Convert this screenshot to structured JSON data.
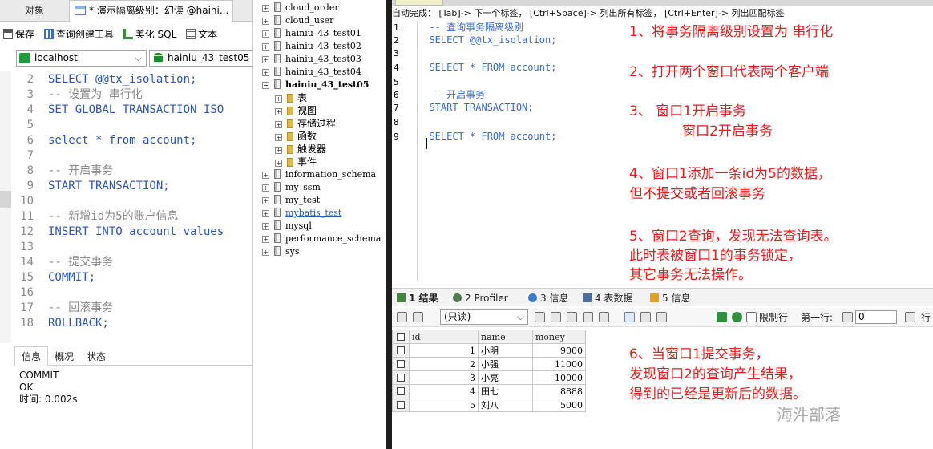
{
  "left": {
    "tabs": {
      "objects": "对象",
      "query": "* 演示隔离级别：幻读 @haini..."
    },
    "toolbar": {
      "save": "保存",
      "query_builder": "查询创建工具",
      "beautify": "美化 SQL",
      "text": "文本"
    },
    "connection": {
      "host": "localhost",
      "database": "hainiu_43_test05"
    },
    "code_lines": [
      {
        "n": "2",
        "text": "SELECT @@tx_isolation;",
        "kind": "kw"
      },
      {
        "n": "3",
        "text": "-- 设置为 串行化",
        "kind": "cm"
      },
      {
        "n": "4",
        "text": "SET GLOBAL TRANSACTION ISO",
        "kind": "kw"
      },
      {
        "n": "5",
        "text": "",
        "kind": "id"
      },
      {
        "n": "6",
        "text": "select * from account;",
        "kind": "mixed"
      },
      {
        "n": "7",
        "text": "",
        "kind": "id"
      },
      {
        "n": "8",
        "text": "-- 开启事务",
        "kind": "cm"
      },
      {
        "n": "9",
        "text": "START TRANSACTION;",
        "kind": "kw"
      },
      {
        "n": "10",
        "text": "",
        "kind": "id"
      },
      {
        "n": "11",
        "text": "-- 新增id为5的账户信息",
        "kind": "cm"
      },
      {
        "n": "12",
        "text": "INSERT INTO account values",
        "kind": "mixed2"
      },
      {
        "n": "13",
        "text": "",
        "kind": "id"
      },
      {
        "n": "14",
        "text": "-- 提交事务",
        "kind": "cm"
      },
      {
        "n": "15",
        "text": "COMMIT;",
        "kind": "kw"
      },
      {
        "n": "16",
        "text": "",
        "kind": "id"
      },
      {
        "n": "17",
        "text": "-- 回滚事务",
        "kind": "cm"
      },
      {
        "n": "18",
        "text": "ROLLBACK;",
        "kind": "kw"
      }
    ],
    "bottom_tabs": [
      "信息",
      "概况",
      "状态"
    ],
    "messages": [
      "COMMIT",
      "OK",
      "时间: 0.002s"
    ]
  },
  "tree": [
    {
      "label": "cloud_order",
      "type": "db",
      "indent": 0
    },
    {
      "label": "cloud_user",
      "type": "db",
      "indent": 0
    },
    {
      "label": "hainiu_43_test01",
      "type": "db",
      "indent": 0
    },
    {
      "label": "hainiu_43_test02",
      "type": "db",
      "indent": 0
    },
    {
      "label": "hainiu_43_test03",
      "type": "db",
      "indent": 0
    },
    {
      "label": "hainiu_43_test04",
      "type": "db",
      "indent": 0
    },
    {
      "label": "hainiu_43_test05",
      "type": "db-open",
      "indent": 0
    },
    {
      "label": "表",
      "type": "folder",
      "indent": 1
    },
    {
      "label": "视图",
      "type": "folder",
      "indent": 1
    },
    {
      "label": "存储过程",
      "type": "folder",
      "indent": 1
    },
    {
      "label": "函数",
      "type": "folder",
      "indent": 1
    },
    {
      "label": "触发器",
      "type": "folder",
      "indent": 1
    },
    {
      "label": "事件",
      "type": "folder",
      "indent": 1
    },
    {
      "label": "information_schema",
      "type": "db",
      "indent": 0
    },
    {
      "label": "my_ssm",
      "type": "db",
      "indent": 0
    },
    {
      "label": "my_test",
      "type": "db",
      "indent": 0
    },
    {
      "label": "mybatis_test",
      "type": "db-link",
      "indent": 0
    },
    {
      "label": "mysql",
      "type": "db",
      "indent": 0
    },
    {
      "label": "performance_schema",
      "type": "db",
      "indent": 0
    },
    {
      "label": "sys",
      "type": "db",
      "indent": 0
    }
  ],
  "right": {
    "hint": "自动完成： [Tab]-> 下一个标签， [Ctrl+Space]-> 列出所有标签， [Ctrl+Enter]-> 列出匹配标签",
    "editor_lines": [
      {
        "n": "1",
        "text": "  -- 查询事务隔离级别",
        "kind": "cm"
      },
      {
        "n": "2",
        "text": "  SELECT @@tx_isolation;",
        "kind": "sel"
      },
      {
        "n": "3",
        "text": "",
        "kind": "plain"
      },
      {
        "n": "4",
        "text": "  SELECT * FROM account;",
        "kind": "star"
      },
      {
        "n": "5",
        "text": "",
        "kind": "plain"
      },
      {
        "n": "6",
        "text": "  -- 开启事务",
        "kind": "cm"
      },
      {
        "n": "7",
        "text": "  START TRANSACTION;",
        "kind": "kw"
      },
      {
        "n": "8",
        "text": "",
        "kind": "plain"
      },
      {
        "n": "9",
        "text": "  SELECT * FROM account;",
        "kind": "star"
      }
    ],
    "notes": {
      "n1": "1、将事务隔离级别设置为 串行化",
      "n2": "2、打开两个窗口代表两个客户端",
      "n3a": "3、      窗口1开启事务",
      "n3b": "窗口2开启事务",
      "n4a": "4、窗口1添加一条id为5的数据，",
      "n4b": "但不提交或者回滚事务",
      "n5a": "5、窗口2查询，发现无法查询表。",
      "n5b": "此时表被窗口1的事务锁定，",
      "n5c": "其它事务无法操作。",
      "n6a": "6、当窗口1提交事务，",
      "n6b": "发现窗口2的查询产生结果，",
      "n6c": "得到的已经是更新后的数据。"
    },
    "result_tabs": [
      {
        "num": "1",
        "label": "结果"
      },
      {
        "num": "2",
        "label": "Profiler"
      },
      {
        "num": "3",
        "label": "信息"
      },
      {
        "num": "4",
        "label": "表数据"
      },
      {
        "num": "5",
        "label": "信息"
      }
    ],
    "readonly_select": "(只读)",
    "limit_label": "限制行",
    "first_row_label": "第一行:",
    "first_row_value": "0",
    "row_label": "行",
    "columns": [
      "id",
      "name",
      "money"
    ],
    "rows": [
      {
        "id": "1",
        "name": "小明",
        "money": "9000"
      },
      {
        "id": "2",
        "name": "小强",
        "money": "11000"
      },
      {
        "id": "3",
        "name": "小亮",
        "money": "10000"
      },
      {
        "id": "4",
        "name": "田七",
        "money": "8888"
      },
      {
        "id": "5",
        "name": "刘八",
        "money": "5000"
      }
    ],
    "watermark": "海汼部落"
  },
  "colors": {
    "keyword": "#2d55b8",
    "comment": "#8a8a8a",
    "note_red": "#ea1b1b",
    "accent_green": "#1e9b3a"
  }
}
